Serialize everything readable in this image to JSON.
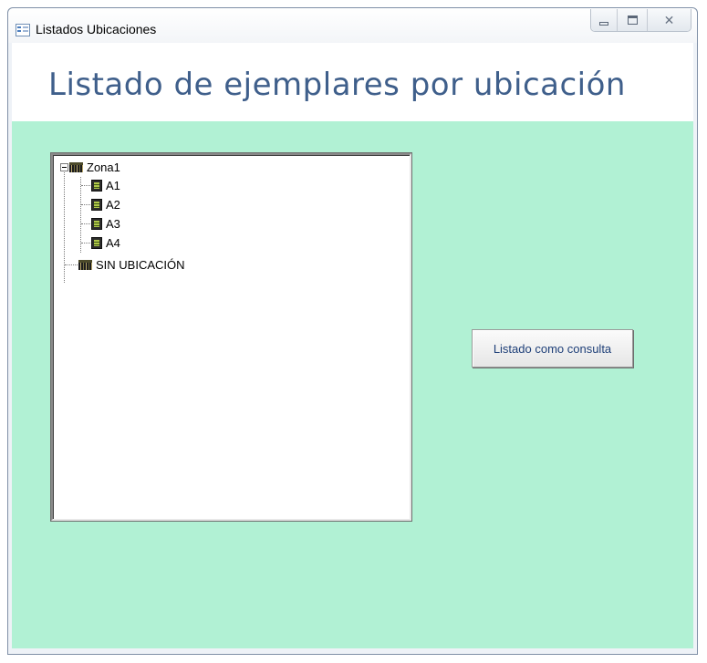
{
  "window": {
    "title": "Listados Ubicaciones",
    "icon": "form-icon",
    "controls": {
      "minimize": "minimize-icon",
      "maximize": "maximize-icon",
      "close_glyph": "✕"
    }
  },
  "form": {
    "heading": "Listado de ejemplares por ubicación",
    "detail_background": "#b1f1d4",
    "heading_color": "#3f5f8b"
  },
  "tree": {
    "root": {
      "label": "Zona1",
      "icon": "zone-icon",
      "expanded": true,
      "children": [
        {
          "label": "A1",
          "icon": "shelf-icon"
        },
        {
          "label": "A2",
          "icon": "shelf-icon"
        },
        {
          "label": "A3",
          "icon": "shelf-icon"
        },
        {
          "label": "A4",
          "icon": "shelf-icon"
        }
      ]
    },
    "unassigned": {
      "label": "SIN UBICACIÓN",
      "icon": "zone-icon"
    }
  },
  "buttons": {
    "consulta_label": "Listado como consulta"
  }
}
